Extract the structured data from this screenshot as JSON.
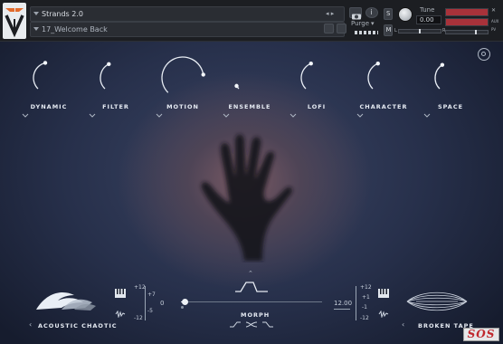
{
  "header": {
    "instrument_name": "Strands 2.0",
    "preset_name": "17_Welcome Back",
    "purge_label": "Purge",
    "tune_label": "Tune",
    "tune_value": "0.00",
    "s_label": "S",
    "m_label": "M",
    "aux_label": "AUX",
    "pv_label": "PV",
    "left_label": "L",
    "right_label": "R",
    "accent_color": "#e26a2c"
  },
  "knobs": [
    {
      "label": "DYNAMIC",
      "level": 0.45
    },
    {
      "label": "FILTER",
      "level": 0.4
    },
    {
      "label": "MOTION",
      "level": 0.8
    },
    {
      "label": "ENSEMBLE",
      "level": 0.05
    },
    {
      "label": "LOFI",
      "level": 0.42
    },
    {
      "label": "CHARACTER",
      "level": 0.42
    },
    {
      "label": "SPACE",
      "level": 0.38
    }
  ],
  "left_engine": {
    "name": "ACOUSTIC CHAOTIC",
    "octave_ticks": [
      "+12",
      "+7",
      "0",
      "-5",
      "-12"
    ],
    "value": "0"
  },
  "morph": {
    "label": "MORPH",
    "level": 0.03
  },
  "right_engine": {
    "name": "BROKEN TAPE",
    "value": "12.00",
    "octave_ticks": [
      "+12",
      "+1",
      "-1",
      "-12"
    ]
  },
  "badge": {
    "text": "SOS"
  },
  "icons": [
    "settings-icon",
    "camera-icon",
    "info-icon",
    "save-icon",
    "delete-icon",
    "piano-icon",
    "waveform-icon",
    "chevron-down-icon",
    "chevron-up-icon",
    "chevron-left-icon",
    "chevron-right-icon"
  ]
}
